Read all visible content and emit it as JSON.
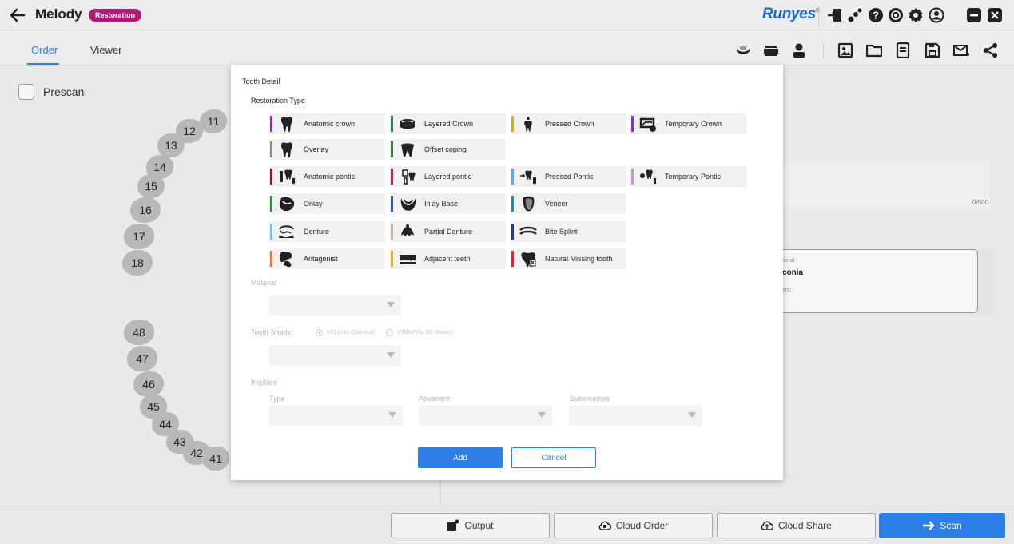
{
  "app": {
    "name": "Melody",
    "badge": "Restoration",
    "brand": "Runyes",
    "brand_mark": "®"
  },
  "tabs": [
    {
      "label": "Order",
      "active": true
    },
    {
      "label": "Viewer",
      "active": false
    }
  ],
  "titlebar_icons": [
    "import-icon",
    "connect-icon",
    "help-icon",
    "record-icon",
    "settings-icon",
    "user-icon",
    "minimize-icon",
    "close-icon"
  ],
  "toolbar_icons": [
    "scanner-icon",
    "printer-icon",
    "user-profile-icon",
    "image-icon",
    "folder-icon",
    "document-icon",
    "save-icon",
    "mail-icon",
    "share-icon"
  ],
  "left_panel": {
    "prescan_label": "Prescan",
    "teeth_upper": [
      "11",
      "12",
      "13",
      "14",
      "15",
      "16",
      "17",
      "18"
    ],
    "teeth_lower": [
      "48",
      "47",
      "46",
      "45",
      "44",
      "43",
      "42",
      "41"
    ]
  },
  "right_panel": {
    "notes_counter": "0/500",
    "material_label": "terial:",
    "material_value": "conia",
    "implant_label": "ent:"
  },
  "modal": {
    "title": "Tooth Detail",
    "restoration_type_label": "Restoration Type",
    "restoration_types": [
      {
        "label": "Anatomic crown",
        "color": "#9b24b8",
        "icon": "anatomic-crown-icon"
      },
      {
        "label": "Layered Crown",
        "color": "#1e8a4a",
        "icon": "layered-crown-icon"
      },
      {
        "label": "Pressed Crown",
        "color": "#c9b22a",
        "icon": "pressed-crown-icon"
      },
      {
        "label": "Temporary Crown",
        "color": "#8a2be2",
        "icon": "temporary-crown-icon"
      },
      {
        "label": "Overlay",
        "color": "#888888",
        "icon": "overlay-icon"
      },
      {
        "label": "Offset coping",
        "color": "#2f7d3a",
        "icon": "offset-coping-icon"
      },
      {
        "label": "Anatomic pontic",
        "color": "#8b1538",
        "icon": "anatomic-pontic-icon"
      },
      {
        "label": "Layered pontic",
        "color": "#c2185b",
        "icon": "layered-pontic-icon"
      },
      {
        "label": "Pressed Pontic",
        "color": "#5aa9e6",
        "icon": "pressed-pontic-icon"
      },
      {
        "label": "Temporary Pontic",
        "color": "#cf8fd6",
        "icon": "temporary-pontic-icon"
      },
      {
        "label": "Onlay",
        "color": "#2e8b2e",
        "icon": "onlay-icon"
      },
      {
        "label": "Inlay Base",
        "color": "#1f4fb8",
        "icon": "inlay-base-icon"
      },
      {
        "label": "Veneer",
        "color": "#2a8c9c",
        "icon": "veneer-icon"
      },
      {
        "label": "Denture",
        "color": "#6ec6e6",
        "icon": "denture-icon"
      },
      {
        "label": "Partial Denture",
        "color": "#c8b49a",
        "icon": "partial-denture-icon"
      },
      {
        "label": "Bite Splint",
        "color": "#2a3a7a",
        "icon": "bite-splint-icon"
      },
      {
        "label": "Antagonist",
        "color": "#e8782a",
        "icon": "antagonist-icon"
      },
      {
        "label": "Adjacent teeth",
        "color": "#e8a82a",
        "icon": "adjacent-teeth-icon"
      },
      {
        "label": "Natural Missing tooth",
        "color": "#d9263a",
        "icon": "natural-missing-tooth-icon"
      }
    ],
    "material_label": "Material",
    "tooth_shade_label": "Tooth Shade",
    "shade_options": [
      "VCL(Vita Classical)",
      "V3DM(Vita 3D Master)"
    ],
    "implant_label": "Implant",
    "implant_type_label": "Type",
    "abutment_label": "Abutment",
    "substructure_label": "Substructure",
    "add_label": "Add",
    "cancel_label": "Cancel"
  },
  "bottom": {
    "output_label": "Output",
    "cloud_order_label": "Cloud Order",
    "cloud_share_label": "Cloud Share",
    "scan_label": "Scan"
  }
}
